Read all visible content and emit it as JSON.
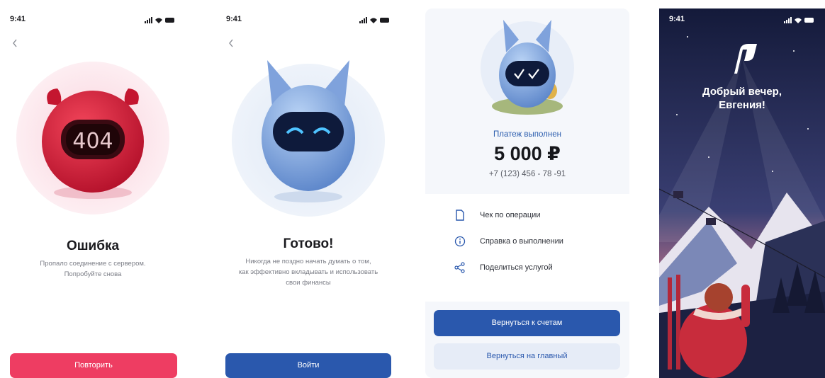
{
  "status": {
    "time": "9:41"
  },
  "colors": {
    "error": "#ee3d62",
    "primary": "#2a58ad",
    "accent_light": "#e6ecf7",
    "night": "#1c2142"
  },
  "error_screen": {
    "code": "404",
    "title": "Ошибка",
    "subtitle_line1": "Пропало соединение с сервером.",
    "subtitle_line2": "Попробуйте снова",
    "retry_label": "Повторить"
  },
  "done_screen": {
    "title": "Готово!",
    "subtitle_line1": "Никогда не поздно начать думать о том,",
    "subtitle_line2": "как эффективно вкладывать и использовать",
    "subtitle_line3": "свои финансы",
    "login_label": "Войти"
  },
  "payment_screen": {
    "status_label": "Платеж выполнен",
    "amount": "5 000 ₽",
    "phone": "+7 (123) 456 - 78 -91",
    "actions": [
      {
        "label": "Чек по операции",
        "icon": "receipt-icon"
      },
      {
        "label": "Справка о выполнении",
        "icon": "info-icon"
      },
      {
        "label": "Поделиться услугой",
        "icon": "share-icon"
      }
    ],
    "primary_label": "Вернуться к счетам",
    "secondary_label": "Вернуться на главный"
  },
  "greeting_screen": {
    "line1": "Добрый вечер,",
    "line2": "Евгения!"
  }
}
